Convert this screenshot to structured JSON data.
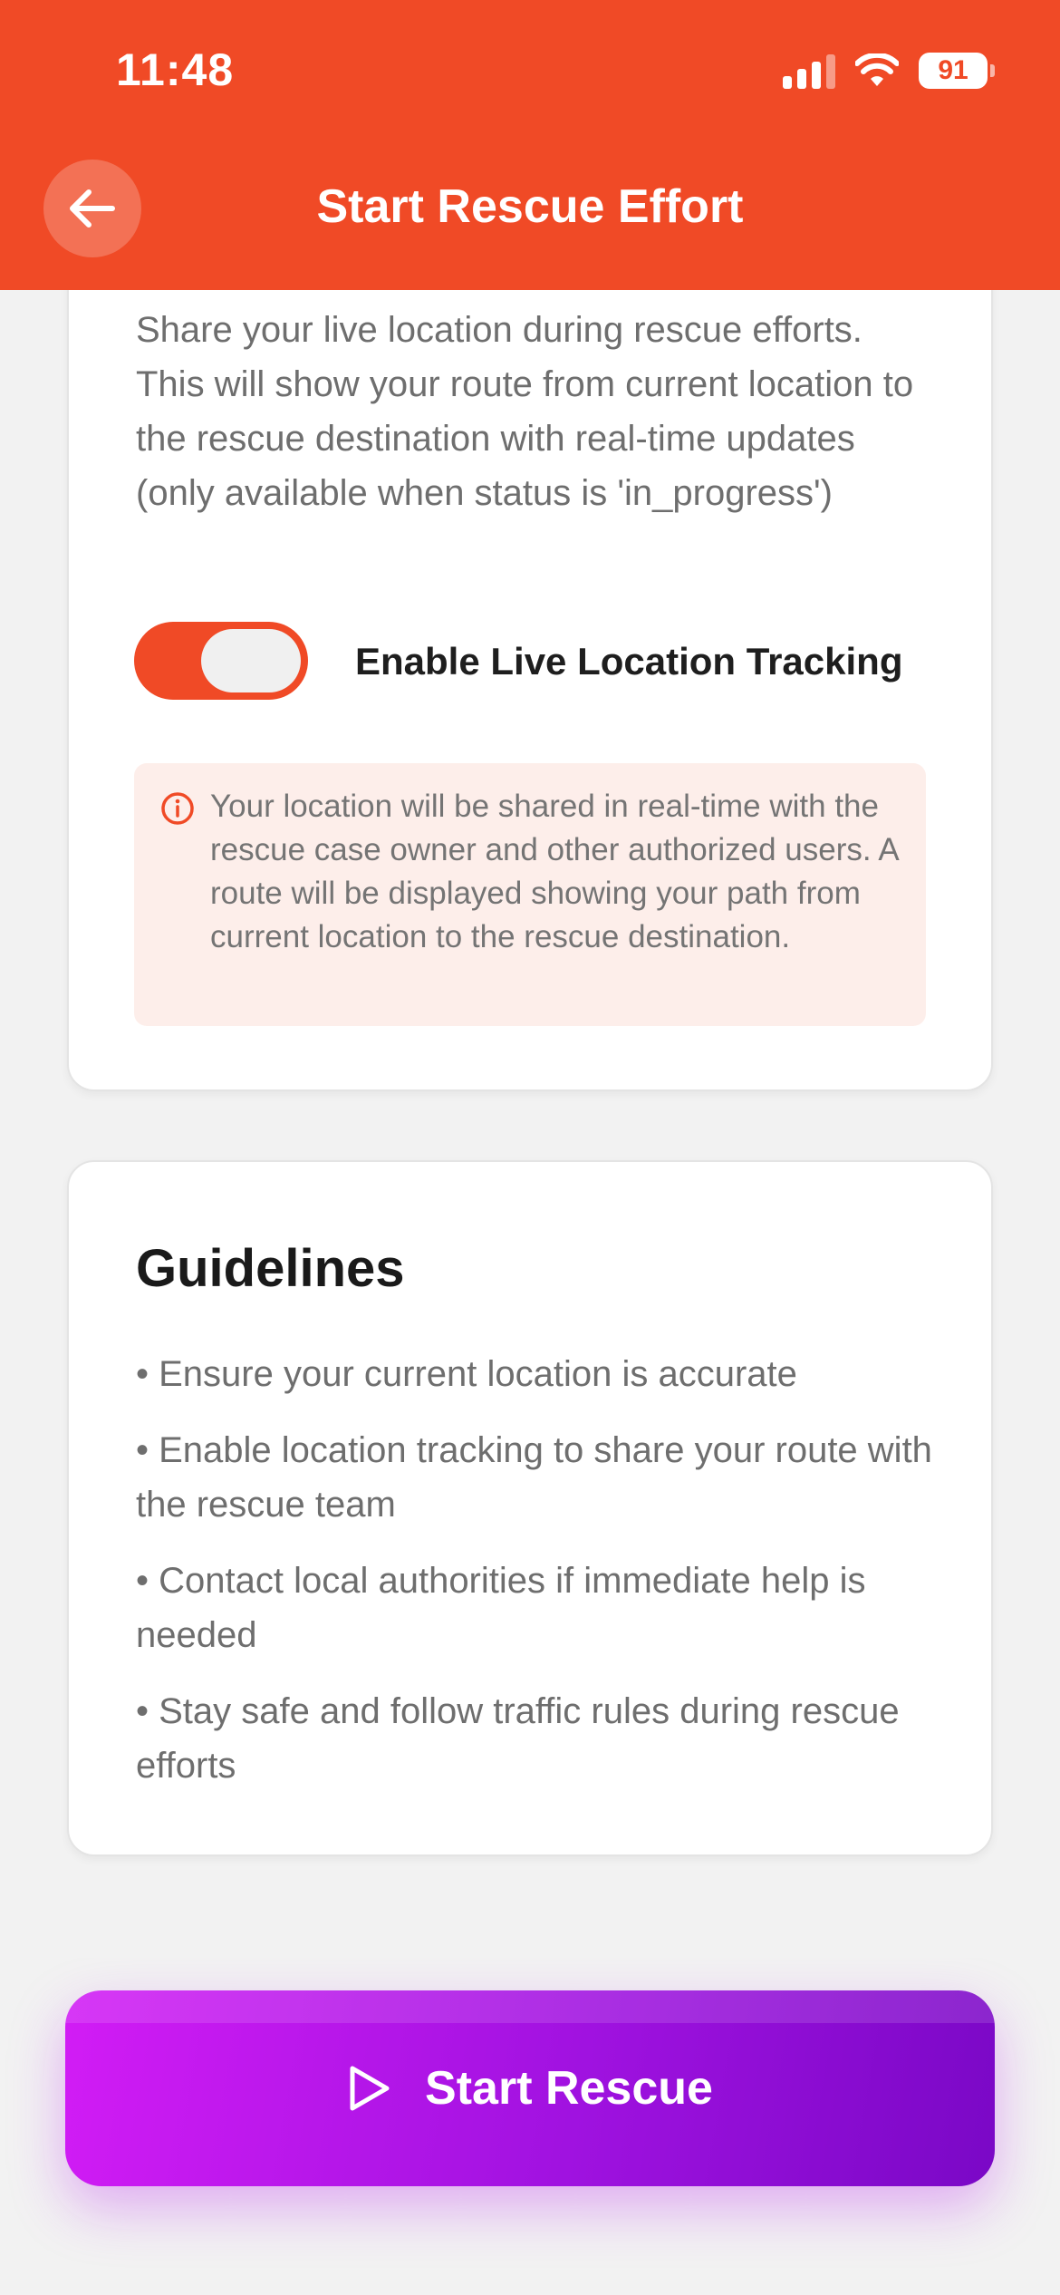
{
  "status_bar": {
    "time": "11:48",
    "battery": "91"
  },
  "header": {
    "title": "Start Rescue Effort"
  },
  "location_card": {
    "description": "Share your live location during rescue efforts. This will show your route from current location to the rescue destination with real-time updates (only available when status is 'in_progress')",
    "toggle_label": "Enable Live Location Tracking",
    "toggle_on": true,
    "info_text": "Your location will be shared in real-time with the rescue case owner and other authorized users. A route will be displayed showing your path from current location to the rescue destination."
  },
  "guidelines": {
    "title": "Guidelines",
    "items": [
      "• Ensure your current location is accurate",
      "• Enable location tracking to share your route with the rescue team",
      "• Contact local authorities if immediate help is needed",
      "• Stay safe and follow traffic rules during rescue efforts"
    ]
  },
  "action": {
    "start_label": "Start Rescue"
  },
  "colors": {
    "accent": "#f04a26",
    "button_start": "#d21cf5",
    "button_end": "#7a08c6"
  }
}
